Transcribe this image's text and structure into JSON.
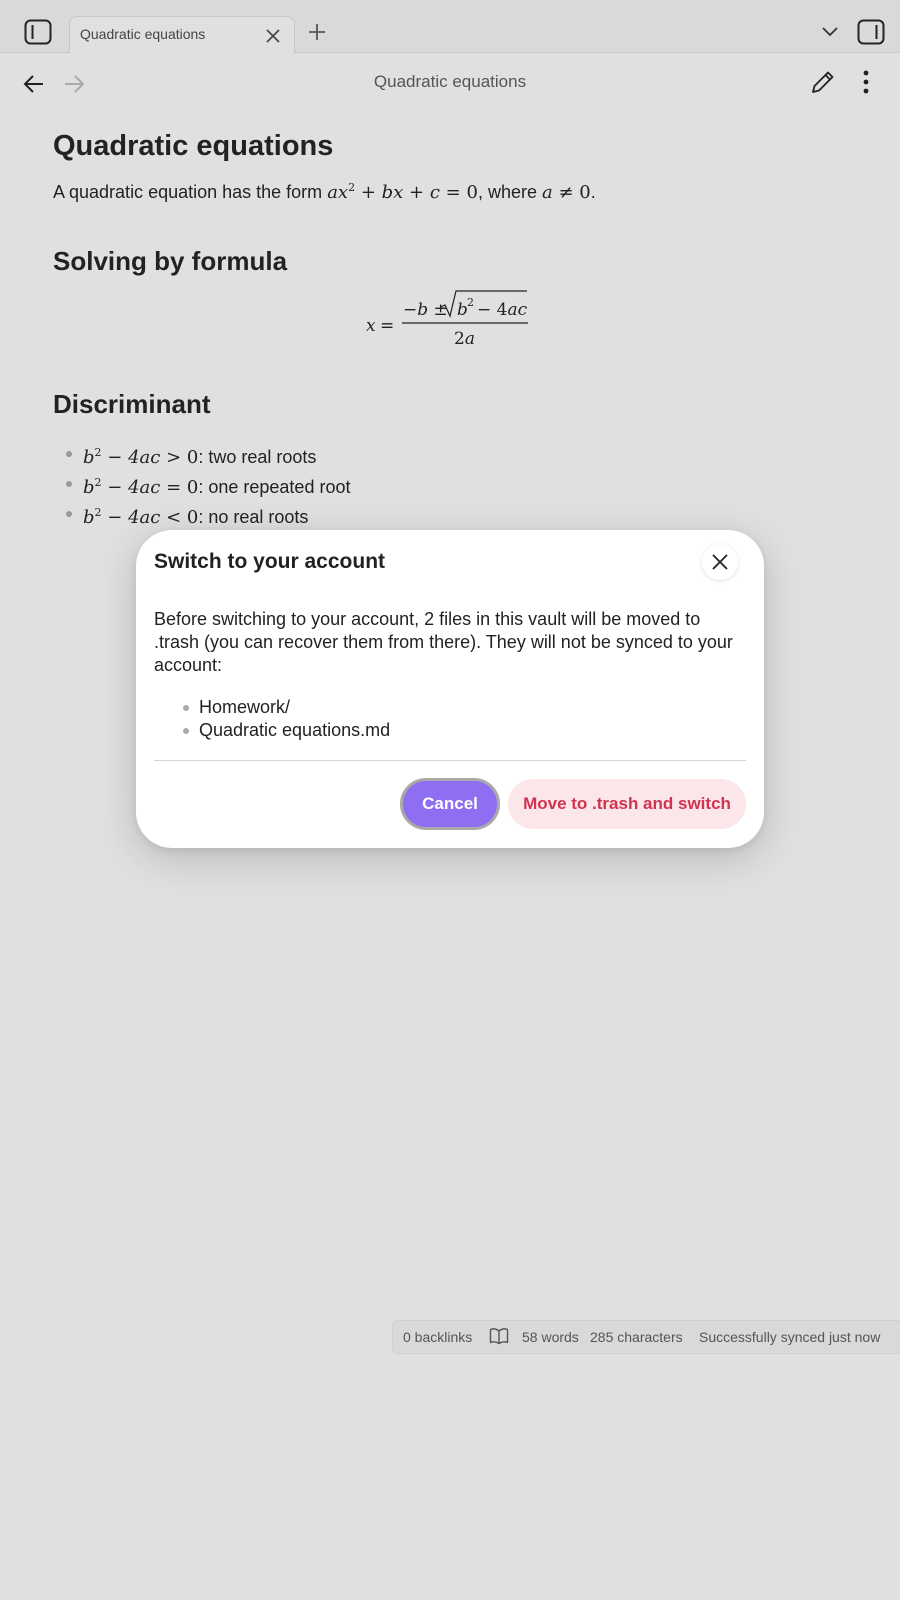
{
  "tabbar": {
    "tab_title": "Quadratic equations",
    "icons": [
      "sidebar-left-icon",
      "close-icon",
      "plus-icon",
      "chevron-down-icon",
      "sidebar-right-icon"
    ]
  },
  "nav": {
    "title": "Quadratic equations"
  },
  "document": {
    "title": "Quadratic equations",
    "intro_prefix": "A quadratic equation has the form",
    "intro_middle": ", where",
    "intro_suffix": ".",
    "section1_title": "Solving by formula",
    "section2_title": "Discriminant",
    "bullets": [
      {
        "relation": ">",
        "text": ": two real roots"
      },
      {
        "relation": "=",
        "text": ": one repeated root"
      },
      {
        "relation": "<",
        "text": ": no real roots"
      }
    ]
  },
  "dialog": {
    "title": "Switch to your account",
    "body": "Before switching to your account, 2 files in this vault will be moved to .trash (you can recover them from there). They will not be synced to your account:",
    "files": [
      "Homework/",
      "Quadratic equations.md"
    ],
    "cancel_label": "Cancel",
    "confirm_label": "Move to .trash and switch",
    "colors": {
      "primary": "#8f6ef2",
      "danger_text": "#d2334f",
      "danger_bg": "#fbe6e9"
    }
  },
  "statusbar": {
    "backlinks": "0 backlinks",
    "words": "58 words",
    "characters": "285 characters",
    "sync": "Successfully synced just now"
  }
}
